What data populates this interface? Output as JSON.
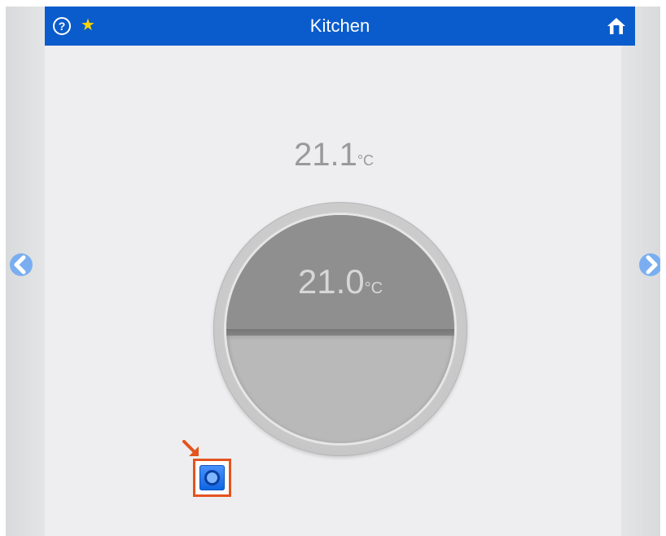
{
  "header": {
    "title": "Kitchen",
    "help_icon": "question-circle-icon",
    "help_glyph": "?",
    "favorite_icon": "star-icon",
    "favorite_glyph": "★",
    "home_icon": "home-icon"
  },
  "thermostat": {
    "current_temperature": "21.1",
    "current_unit": "°C",
    "set_temperature": "21.0",
    "set_unit": "°C"
  },
  "navigation": {
    "previous_icon": "chevron-left-circle-icon",
    "next_icon": "chevron-right-circle-icon"
  },
  "mode_button": {
    "icon": "ring-icon"
  },
  "colors": {
    "header_blue": "#0a5ccc",
    "nav_arrow_blue": "#7aaef0",
    "highlight_orange": "#e3541e",
    "star_yellow": "#ffd400"
  }
}
